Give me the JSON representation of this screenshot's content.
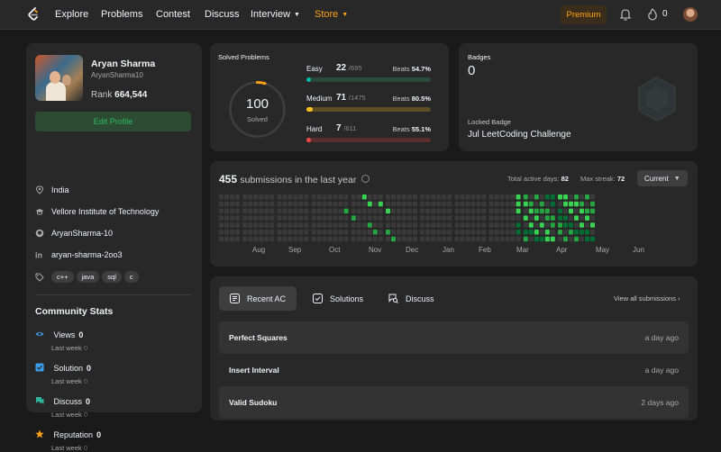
{
  "nav": {
    "items": [
      {
        "label": "Explore"
      },
      {
        "label": "Problems"
      },
      {
        "label": "Contest"
      },
      {
        "label": "Discuss"
      },
      {
        "label": "Interview"
      },
      {
        "label": "Store"
      }
    ],
    "premium_label": "Premium",
    "streak_count": "0",
    "colors": {
      "accent": "#ffa116",
      "background": "#282828"
    }
  },
  "profile": {
    "name": "Aryan Sharma",
    "handle": "AryanSharma10",
    "rank_label": "Rank",
    "rank_value": "664,544",
    "edit_label": "Edit Profile",
    "location": "India",
    "school": "Vellore Institute of Technology",
    "github": "AryanSharma-10",
    "linkedin": "aryan-sharma-2oo3",
    "skills": [
      "c++",
      "java",
      "sql",
      "c"
    ]
  },
  "community": {
    "title": "Community Stats",
    "stats": [
      {
        "label": "Views",
        "value": "0",
        "last_week_label": "Last week",
        "last_week_value": "0",
        "icon": "eye-icon",
        "color": "#3b9ded"
      },
      {
        "label": "Solution",
        "value": "0",
        "last_week_label": "Last week",
        "last_week_value": "0",
        "icon": "check-square-icon",
        "color": "#3b9ded"
      },
      {
        "label": "Discuss",
        "value": "0",
        "last_week_label": "Last week",
        "last_week_value": "0",
        "icon": "chat-icon",
        "color": "#2fb59c"
      },
      {
        "label": "Reputation",
        "value": "0",
        "last_week_label": "Last week",
        "last_week_value": "0",
        "icon": "star-icon",
        "color": "#ffa116"
      }
    ]
  },
  "solved": {
    "title": "Solved Problems",
    "total": "100",
    "total_label": "Solved",
    "difficulties": [
      {
        "label": "Easy",
        "count": "22",
        "total": "/695",
        "beats_label": "Beats",
        "beats": "54.7%",
        "fraction": 0.032,
        "color": "#00b8a3",
        "track": "#2a4a3a"
      },
      {
        "label": "Medium",
        "count": "71",
        "total": "/1475",
        "beats_label": "Beats",
        "beats": "80.5%",
        "fraction": 0.048,
        "color": "#ffc01e",
        "track": "#5e4e23"
      },
      {
        "label": "Hard",
        "count": "7",
        "total": "/611",
        "beats_label": "Beats",
        "beats": "55.1%",
        "fraction": 0.011,
        "color": "#ef4743",
        "track": "#5a2e2e"
      }
    ]
  },
  "badges": {
    "title": "Badges",
    "count": "0",
    "locked_label": "Locked Badge",
    "locked_name": "Jul LeetCoding Challenge"
  },
  "heatmap": {
    "count": "455",
    "text": "submissions in the last year",
    "active_days_label": "Total active days:",
    "active_days": "82",
    "max_streak_label": "Max streak:",
    "max_streak": "72",
    "range_label": "Current",
    "months": [
      "Aug",
      "Sep",
      "Oct",
      "Nov",
      "Dec",
      "Jan",
      "Feb",
      "Mar",
      "Apr",
      "May",
      "Jun"
    ]
  },
  "recent": {
    "tabs": [
      {
        "label": "Recent AC",
        "icon": "list-icon"
      },
      {
        "label": "Solutions",
        "icon": "check-square-icon"
      },
      {
        "label": "Discuss",
        "icon": "chat-search-icon"
      }
    ],
    "view_all": "View all submissions",
    "items": [
      {
        "title": "Perfect Squares",
        "ago": "a day ago"
      },
      {
        "title": "Insert Interval",
        "ago": "a day ago"
      },
      {
        "title": "Valid Sudoku",
        "ago": "2 days ago"
      }
    ]
  }
}
